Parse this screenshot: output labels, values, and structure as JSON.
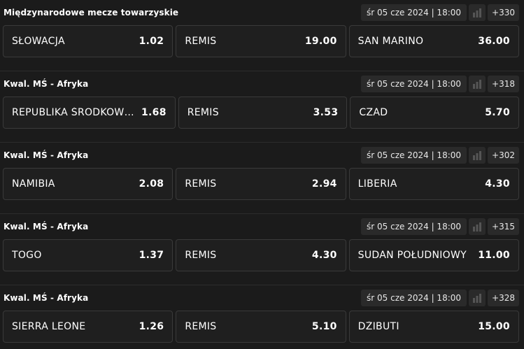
{
  "matches": [
    {
      "league": "Międzynarodowe mecze towarzyskie",
      "date": "śr 05 cze 2024 | 18:00",
      "more": "+330",
      "home": {
        "name": "SŁOWACJA",
        "odd": "1.02"
      },
      "draw": {
        "name": "REMIS",
        "odd": "19.00"
      },
      "away": {
        "name": "SAN MARINO",
        "odd": "36.00"
      }
    },
    {
      "league": "Kwal. MŚ - Afryka",
      "date": "śr 05 cze 2024 | 18:00",
      "more": "+318",
      "home": {
        "name": "REPUBLIKA ŚRODKOWOA...",
        "odd": "1.68"
      },
      "draw": {
        "name": "REMIS",
        "odd": "3.53"
      },
      "away": {
        "name": "CZAD",
        "odd": "5.70"
      }
    },
    {
      "league": "Kwal. MŚ - Afryka",
      "date": "śr 05 cze 2024 | 18:00",
      "more": "+302",
      "home": {
        "name": "NAMIBIA",
        "odd": "2.08"
      },
      "draw": {
        "name": "REMIS",
        "odd": "2.94"
      },
      "away": {
        "name": "LIBERIA",
        "odd": "4.30"
      }
    },
    {
      "league": "Kwal. MŚ - Afryka",
      "date": "śr 05 cze 2024 | 18:00",
      "more": "+315",
      "home": {
        "name": "TOGO",
        "odd": "1.37"
      },
      "draw": {
        "name": "REMIS",
        "odd": "4.30"
      },
      "away": {
        "name": "SUDAN POŁUDNIOWY",
        "odd": "11.00"
      }
    },
    {
      "league": "Kwal. MŚ - Afryka",
      "date": "śr 05 cze 2024 | 18:00",
      "more": "+328",
      "home": {
        "name": "SIERRA LEONE",
        "odd": "1.26"
      },
      "draw": {
        "name": "REMIS",
        "odd": "5.10"
      },
      "away": {
        "name": "DŻIBUTI",
        "odd": "15.00"
      }
    }
  ],
  "icons": {
    "stats": "stats-bars-icon"
  },
  "colors": {
    "background": "#1b1b1b",
    "button": "#1f1f1f",
    "border": "#3a3a3a",
    "chip": "#2a2a2a"
  }
}
